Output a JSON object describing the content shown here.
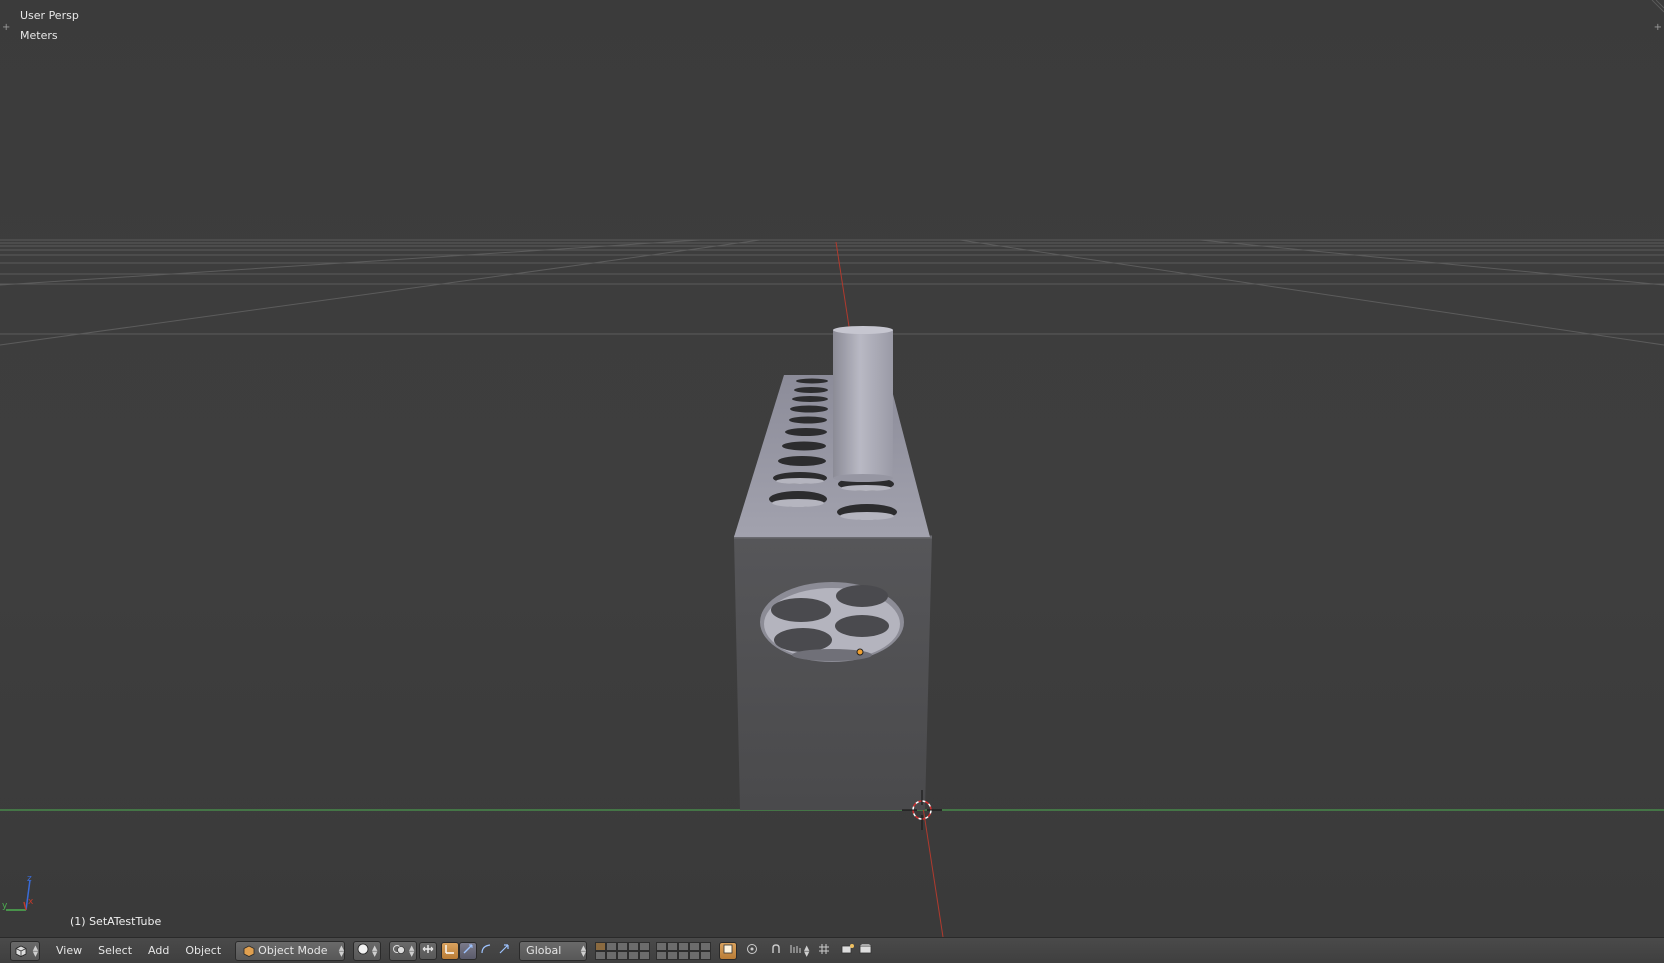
{
  "viewport": {
    "view_name": "User Persp",
    "units": "Meters",
    "active_object": "(1) SetATestTube",
    "axis_labels": {
      "x": "x",
      "y": "y",
      "z": "z"
    },
    "colors": {
      "x_axis": "#c0392b",
      "y_axis": "#4caf50",
      "z_axis": "#3a6bd6",
      "grid_line": "#5a5a5a",
      "mesh_light": "#9c9ca8",
      "mesh_dark": "#4f4f52"
    }
  },
  "header": {
    "editor_type_icon": "3d-view-icon",
    "menus": [
      "View",
      "Select",
      "Add",
      "Object"
    ],
    "mode": "Object Mode",
    "mode_icon": "cube-icon",
    "viewport_shading_icon": "sphere-icon",
    "pivot_icon": "pivot-icon",
    "manipulator_icons": [
      "manipulator-toggle-icon",
      "translate-icon",
      "rotate-icon",
      "scale-icon"
    ],
    "transform_orientation": "Global",
    "layers_count": 20,
    "snap_icons": [
      "lock-camera-icon",
      "proportional-edit-icon",
      "snap-icon",
      "snap-element-icon",
      "render-icon",
      "render-animation-icon"
    ]
  }
}
